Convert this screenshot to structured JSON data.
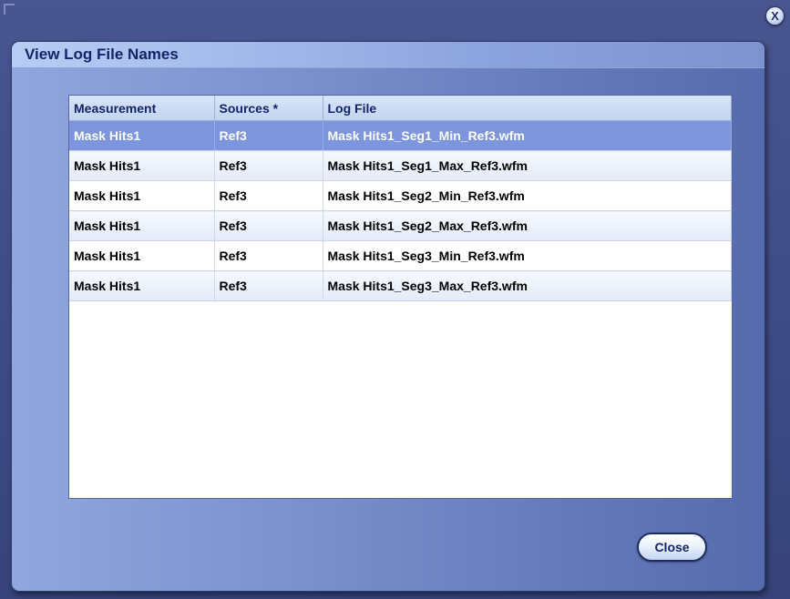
{
  "dialog": {
    "title": "View Log File Names",
    "close_label": "Close",
    "dismiss_glyph": "X",
    "icons": {
      "dismiss": "close-icon",
      "corner": "resize-corner-icon"
    }
  },
  "table": {
    "columns": [
      "Measurement",
      "Sources *",
      "Log File"
    ],
    "rows": [
      {
        "measurement": "Mask Hits1",
        "source": "Ref3",
        "log_file": "Mask Hits1_Seg1_Min_Ref3.wfm",
        "selected": true
      },
      {
        "measurement": "Mask Hits1",
        "source": "Ref3",
        "log_file": "Mask Hits1_Seg1_Max_Ref3.wfm"
      },
      {
        "measurement": "Mask Hits1",
        "source": "Ref3",
        "log_file": "Mask Hits1_Seg2_Min_Ref3.wfm"
      },
      {
        "measurement": "Mask Hits1",
        "source": "Ref3",
        "log_file": "Mask Hits1_Seg2_Max_Ref3.wfm"
      },
      {
        "measurement": "Mask Hits1",
        "source": "Ref3",
        "log_file": "Mask Hits1_Seg3_Min_Ref3.wfm"
      },
      {
        "measurement": "Mask Hits1",
        "source": "Ref3",
        "log_file": "Mask Hits1_Seg3_Max_Ref3.wfm"
      }
    ]
  },
  "colors": {
    "background": "#45518b",
    "selected_row": "#7d95dd",
    "header_text": "#14236a"
  }
}
